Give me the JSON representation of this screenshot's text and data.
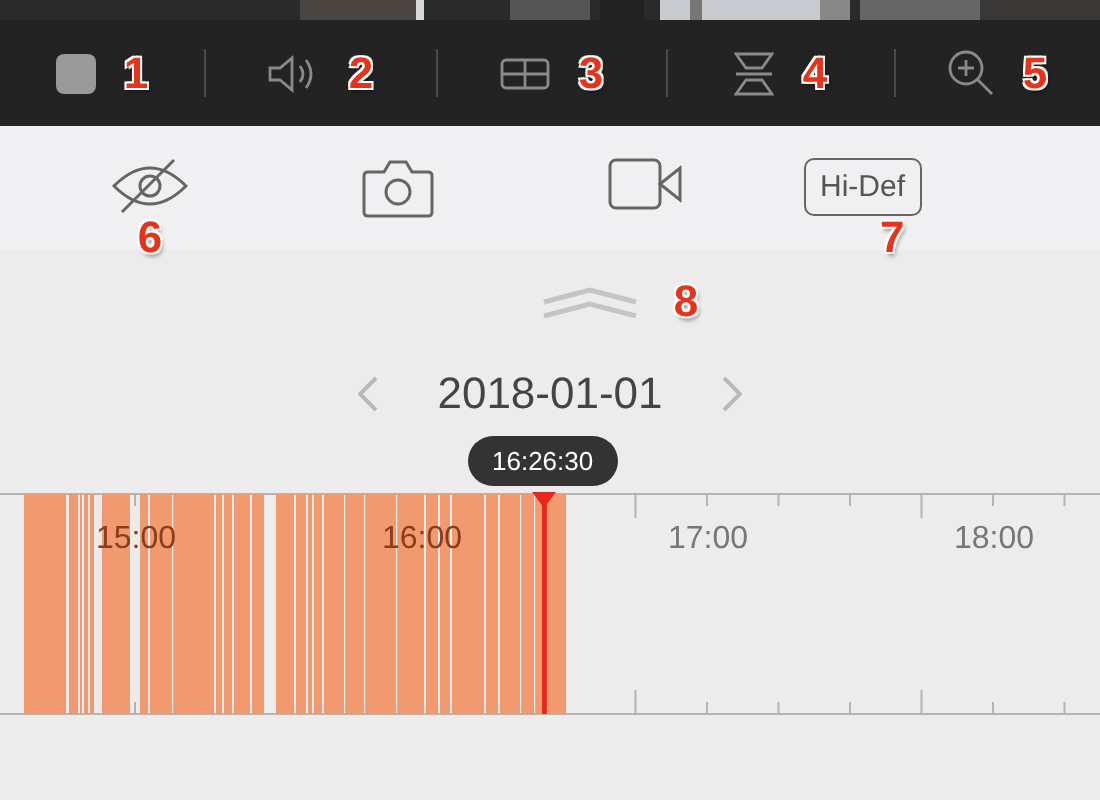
{
  "toolbar": [
    {
      "kind": "stop",
      "callout": "1"
    },
    {
      "kind": "sound",
      "callout": "2"
    },
    {
      "kind": "split",
      "callout": "3"
    },
    {
      "kind": "flip",
      "callout": "4"
    },
    {
      "kind": "zoom",
      "callout": "5"
    }
  ],
  "actions": [
    {
      "kind": "hide",
      "callout": "6"
    },
    {
      "kind": "snapshot"
    },
    {
      "kind": "record"
    },
    {
      "kind": "quality",
      "label": "Hi-Def",
      "callout": "7"
    }
  ],
  "collapse": {
    "callout": "8"
  },
  "date": "2018-01-01",
  "playhead": {
    "time": "16:26:30"
  },
  "timeline": {
    "hour_labels": [
      "15:00",
      "16:00",
      "17:00",
      "18:00"
    ]
  }
}
